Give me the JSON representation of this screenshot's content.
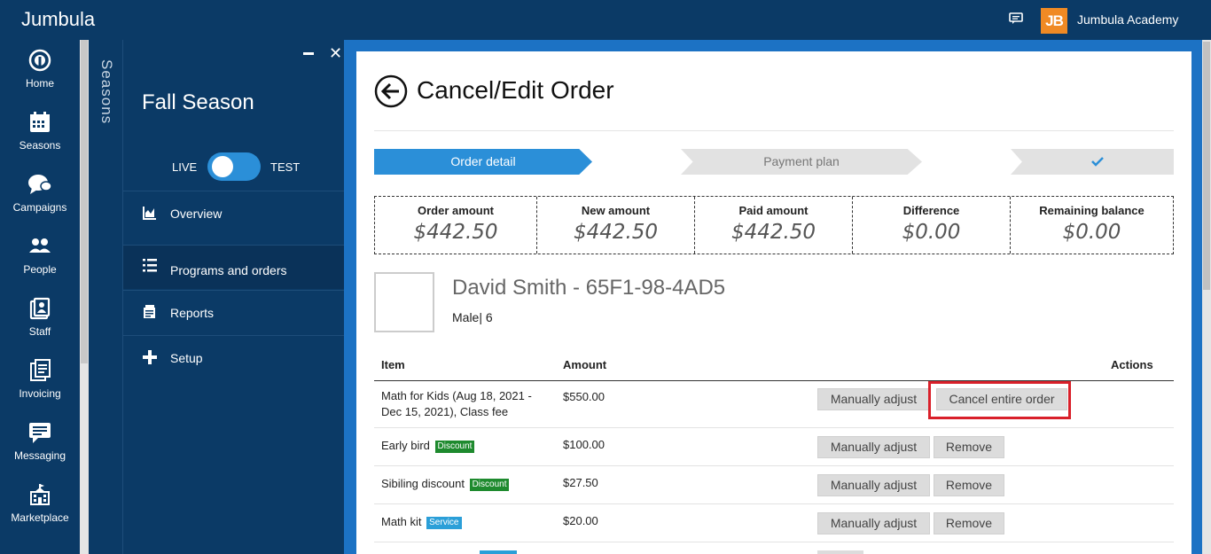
{
  "app": {
    "brand": "Jumbula",
    "org_name": "Jumbula Academy",
    "logo_text": "JB"
  },
  "rail": [
    {
      "label": "Home",
      "icon": "home-icon"
    },
    {
      "label": "Seasons",
      "icon": "calendar-icon"
    },
    {
      "label": "Campaigns",
      "icon": "campaigns-icon"
    },
    {
      "label": "People",
      "icon": "people-icon"
    },
    {
      "label": "Staff",
      "icon": "staff-icon"
    },
    {
      "label": "Invoicing",
      "icon": "invoicing-icon"
    },
    {
      "label": "Messaging",
      "icon": "messaging-icon"
    },
    {
      "label": "Marketplace",
      "icon": "marketplace-icon"
    }
  ],
  "seasons_strip": {
    "label": "Seasons"
  },
  "panel": {
    "title": "Fall Season",
    "toggle": {
      "left": "LIVE",
      "right": "TEST"
    },
    "nav": [
      {
        "label": "Overview",
        "icon": "chart-icon"
      },
      {
        "label": "Programs and orders",
        "icon": "list-icon"
      },
      {
        "label": "Reports",
        "icon": "report-icon"
      },
      {
        "label": "Setup",
        "icon": "plus-icon"
      }
    ]
  },
  "page": {
    "title": "Cancel/Edit Order",
    "steps": [
      "Order detail",
      "Payment plan"
    ],
    "summary": [
      {
        "label": "Order amount",
        "value": "$442.50"
      },
      {
        "label": "New amount",
        "value": "$442.50"
      },
      {
        "label": "Paid amount",
        "value": "$442.50"
      },
      {
        "label": "Difference",
        "value": "$0.00"
      },
      {
        "label": "Remaining balance",
        "value": "$0.00"
      }
    ],
    "person": {
      "name": "David Smith - 65F1-98-4AD5",
      "meta": "Male| 6"
    },
    "table": {
      "headers": {
        "item": "Item",
        "amount": "Amount",
        "actions": "Actions"
      },
      "rows": [
        {
          "item": "Math for Kids (Aug 18, 2021 - Dec 15, 2021), Class fee",
          "badge": "",
          "amount": "$550.00",
          "primary": "Manually adjust",
          "secondary": "Cancel entire order"
        },
        {
          "item": "Early bird",
          "badge": "Discount",
          "amount": "$100.00",
          "primary": "Manually adjust",
          "secondary": "Remove"
        },
        {
          "item": "Sibiling discount",
          "badge": "Discount",
          "amount": "$27.50",
          "primary": "Manually adjust",
          "secondary": "Remove"
        },
        {
          "item": "Math kit",
          "badge": "Service",
          "amount": "$20.00",
          "primary": "Manually adjust",
          "secondary": "Remove"
        }
      ]
    }
  },
  "colors": {
    "navy": "#0b3a66",
    "accent": "#2b8fd8",
    "highlight": "#d9202a",
    "discount": "#1e8a2e",
    "service": "#2b9fd8"
  }
}
